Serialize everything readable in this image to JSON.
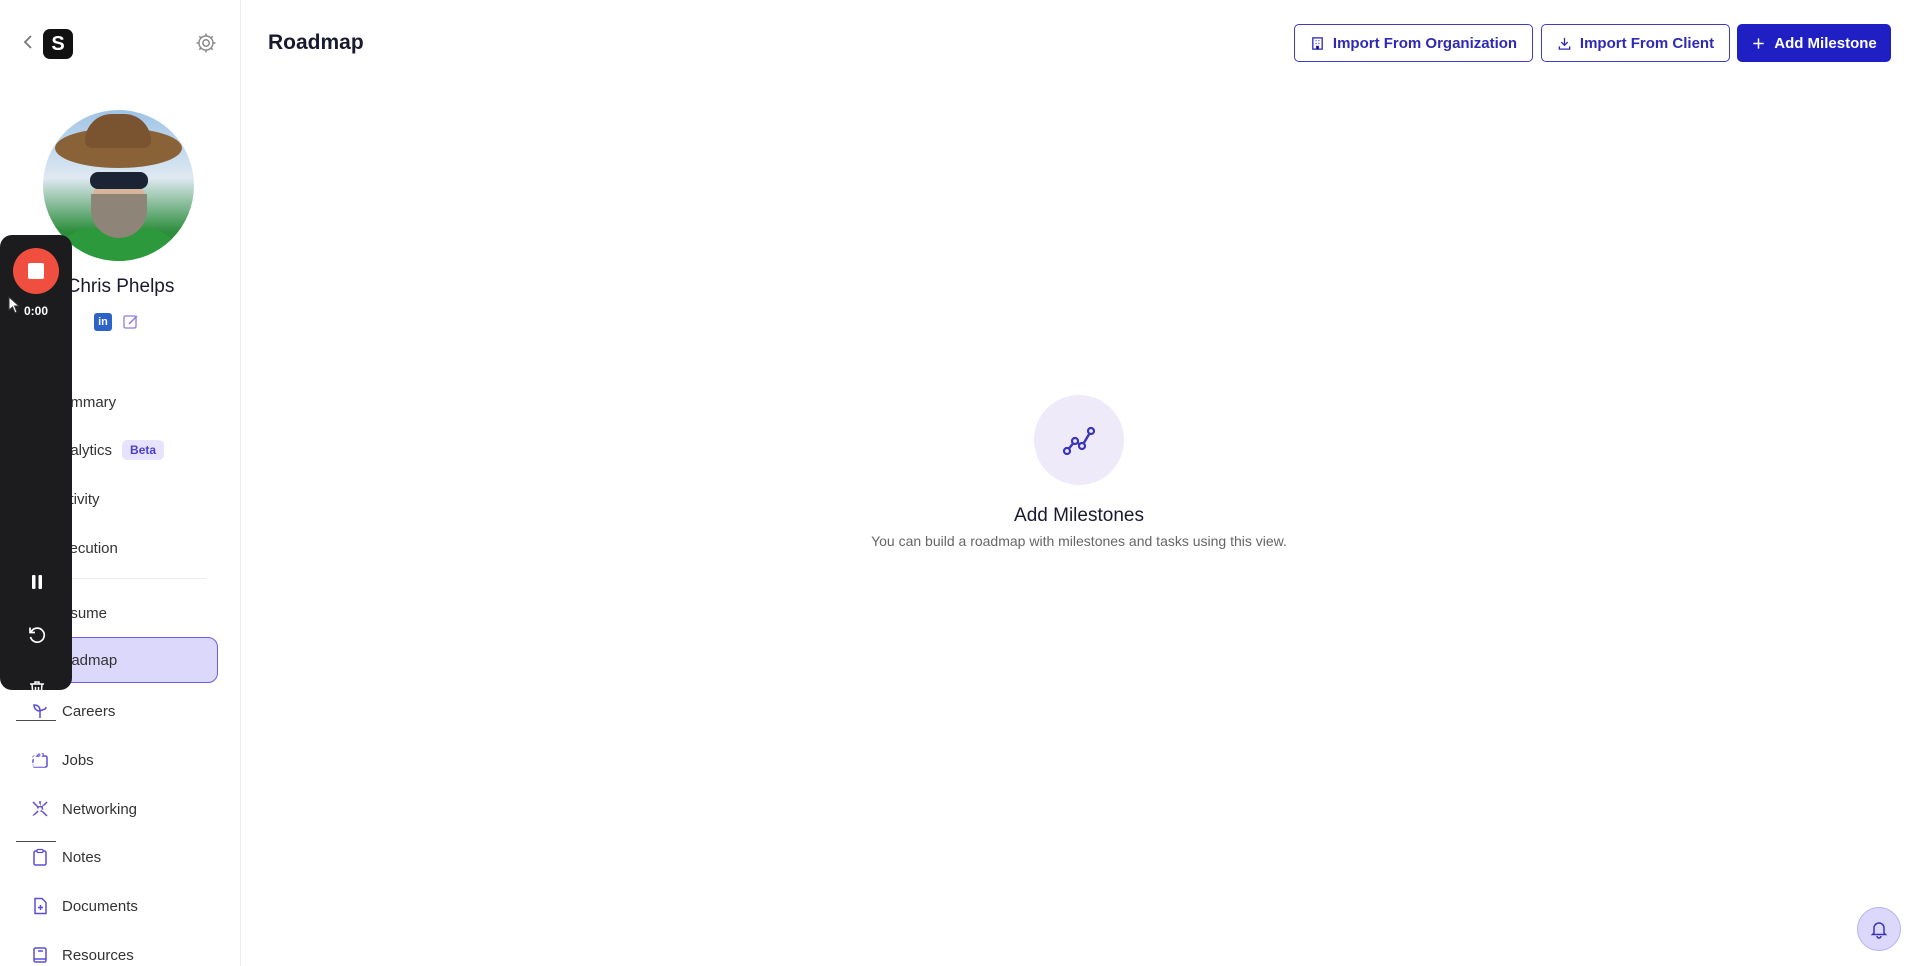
{
  "page": {
    "title": "Roadmap"
  },
  "toolbar": {
    "import_org_label": "Import From Organization",
    "import_client_label": "Import From Client",
    "add_milestone_label": "Add Milestone"
  },
  "profile": {
    "name": "Chris Phelps",
    "linkedin_label": "in"
  },
  "sidebar": {
    "logo_text": "S",
    "items": [
      {
        "label": "ummary",
        "icon": "summary-icon"
      },
      {
        "label": "nalytics",
        "badge": "Beta",
        "icon": "analytics-icon"
      },
      {
        "label": "ctivity",
        "icon": "activity-icon"
      },
      {
        "label": "xecution",
        "icon": "execution-icon"
      },
      {
        "label": "esume",
        "icon": "resume-icon"
      },
      {
        "label": "oadmap",
        "icon": "roadmap-icon",
        "active": true
      },
      {
        "label": "Careers",
        "icon": "sprout-icon"
      },
      {
        "label": "Jobs",
        "icon": "briefcase-icon"
      },
      {
        "label": "Networking",
        "icon": "network-icon"
      },
      {
        "label": "Notes",
        "icon": "clipboard-icon"
      },
      {
        "label": "Documents",
        "icon": "document-icon"
      },
      {
        "label": "Resources",
        "icon": "book-icon"
      }
    ]
  },
  "recorder": {
    "time": "0:00"
  },
  "empty_state": {
    "title": "Add Milestones",
    "subtitle": "You can build a roadmap with milestones and tasks using this view."
  },
  "colors": {
    "accent": "#1f1fc4",
    "active_nav_bg": "#dcd8fb",
    "record": "#f04e3e"
  }
}
